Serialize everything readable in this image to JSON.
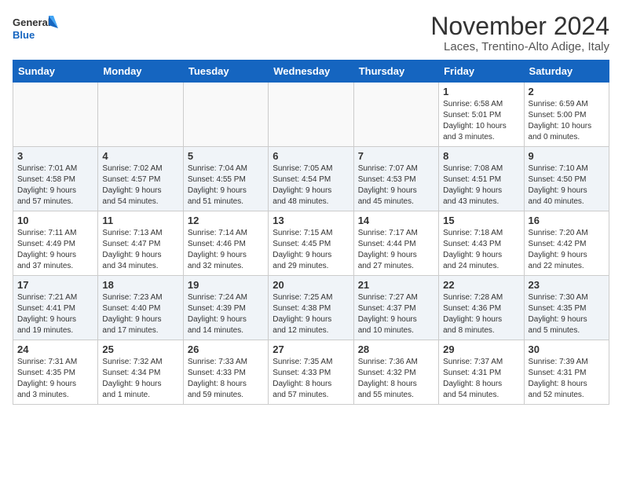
{
  "header": {
    "logo_line1": "General",
    "logo_line2": "Blue",
    "month_title": "November 2024",
    "location": "Laces, Trentino-Alto Adige, Italy"
  },
  "weekdays": [
    "Sunday",
    "Monday",
    "Tuesday",
    "Wednesday",
    "Thursday",
    "Friday",
    "Saturday"
  ],
  "weeks": [
    [
      {
        "day": "",
        "info": ""
      },
      {
        "day": "",
        "info": ""
      },
      {
        "day": "",
        "info": ""
      },
      {
        "day": "",
        "info": ""
      },
      {
        "day": "",
        "info": ""
      },
      {
        "day": "1",
        "info": "Sunrise: 6:58 AM\nSunset: 5:01 PM\nDaylight: 10 hours\nand 3 minutes."
      },
      {
        "day": "2",
        "info": "Sunrise: 6:59 AM\nSunset: 5:00 PM\nDaylight: 10 hours\nand 0 minutes."
      }
    ],
    [
      {
        "day": "3",
        "info": "Sunrise: 7:01 AM\nSunset: 4:58 PM\nDaylight: 9 hours\nand 57 minutes."
      },
      {
        "day": "4",
        "info": "Sunrise: 7:02 AM\nSunset: 4:57 PM\nDaylight: 9 hours\nand 54 minutes."
      },
      {
        "day": "5",
        "info": "Sunrise: 7:04 AM\nSunset: 4:55 PM\nDaylight: 9 hours\nand 51 minutes."
      },
      {
        "day": "6",
        "info": "Sunrise: 7:05 AM\nSunset: 4:54 PM\nDaylight: 9 hours\nand 48 minutes."
      },
      {
        "day": "7",
        "info": "Sunrise: 7:07 AM\nSunset: 4:53 PM\nDaylight: 9 hours\nand 45 minutes."
      },
      {
        "day": "8",
        "info": "Sunrise: 7:08 AM\nSunset: 4:51 PM\nDaylight: 9 hours\nand 43 minutes."
      },
      {
        "day": "9",
        "info": "Sunrise: 7:10 AM\nSunset: 4:50 PM\nDaylight: 9 hours\nand 40 minutes."
      }
    ],
    [
      {
        "day": "10",
        "info": "Sunrise: 7:11 AM\nSunset: 4:49 PM\nDaylight: 9 hours\nand 37 minutes."
      },
      {
        "day": "11",
        "info": "Sunrise: 7:13 AM\nSunset: 4:47 PM\nDaylight: 9 hours\nand 34 minutes."
      },
      {
        "day": "12",
        "info": "Sunrise: 7:14 AM\nSunset: 4:46 PM\nDaylight: 9 hours\nand 32 minutes."
      },
      {
        "day": "13",
        "info": "Sunrise: 7:15 AM\nSunset: 4:45 PM\nDaylight: 9 hours\nand 29 minutes."
      },
      {
        "day": "14",
        "info": "Sunrise: 7:17 AM\nSunset: 4:44 PM\nDaylight: 9 hours\nand 27 minutes."
      },
      {
        "day": "15",
        "info": "Sunrise: 7:18 AM\nSunset: 4:43 PM\nDaylight: 9 hours\nand 24 minutes."
      },
      {
        "day": "16",
        "info": "Sunrise: 7:20 AM\nSunset: 4:42 PM\nDaylight: 9 hours\nand 22 minutes."
      }
    ],
    [
      {
        "day": "17",
        "info": "Sunrise: 7:21 AM\nSunset: 4:41 PM\nDaylight: 9 hours\nand 19 minutes."
      },
      {
        "day": "18",
        "info": "Sunrise: 7:23 AM\nSunset: 4:40 PM\nDaylight: 9 hours\nand 17 minutes."
      },
      {
        "day": "19",
        "info": "Sunrise: 7:24 AM\nSunset: 4:39 PM\nDaylight: 9 hours\nand 14 minutes."
      },
      {
        "day": "20",
        "info": "Sunrise: 7:25 AM\nSunset: 4:38 PM\nDaylight: 9 hours\nand 12 minutes."
      },
      {
        "day": "21",
        "info": "Sunrise: 7:27 AM\nSunset: 4:37 PM\nDaylight: 9 hours\nand 10 minutes."
      },
      {
        "day": "22",
        "info": "Sunrise: 7:28 AM\nSunset: 4:36 PM\nDaylight: 9 hours\nand 8 minutes."
      },
      {
        "day": "23",
        "info": "Sunrise: 7:30 AM\nSunset: 4:35 PM\nDaylight: 9 hours\nand 5 minutes."
      }
    ],
    [
      {
        "day": "24",
        "info": "Sunrise: 7:31 AM\nSunset: 4:35 PM\nDaylight: 9 hours\nand 3 minutes."
      },
      {
        "day": "25",
        "info": "Sunrise: 7:32 AM\nSunset: 4:34 PM\nDaylight: 9 hours\nand 1 minute."
      },
      {
        "day": "26",
        "info": "Sunrise: 7:33 AM\nSunset: 4:33 PM\nDaylight: 8 hours\nand 59 minutes."
      },
      {
        "day": "27",
        "info": "Sunrise: 7:35 AM\nSunset: 4:33 PM\nDaylight: 8 hours\nand 57 minutes."
      },
      {
        "day": "28",
        "info": "Sunrise: 7:36 AM\nSunset: 4:32 PM\nDaylight: 8 hours\nand 55 minutes."
      },
      {
        "day": "29",
        "info": "Sunrise: 7:37 AM\nSunset: 4:31 PM\nDaylight: 8 hours\nand 54 minutes."
      },
      {
        "day": "30",
        "info": "Sunrise: 7:39 AM\nSunset: 4:31 PM\nDaylight: 8 hours\nand 52 minutes."
      }
    ]
  ]
}
